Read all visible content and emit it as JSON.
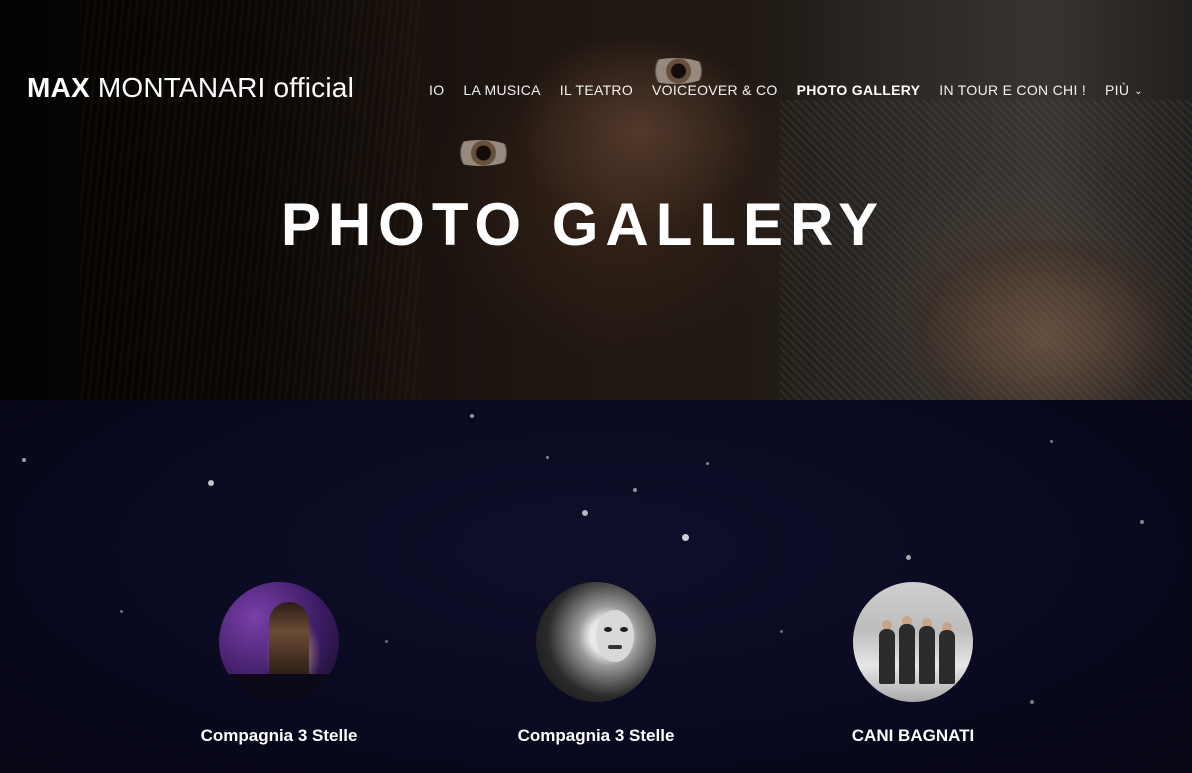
{
  "header": {
    "logo_bold": "MAX",
    "logo_light": "MONTANARI",
    "logo_suffix": "official",
    "nav": [
      {
        "label": "IO",
        "active": false
      },
      {
        "label": "LA MUSICA",
        "active": false
      },
      {
        "label": "IL TEATRO",
        "active": false
      },
      {
        "label": "VOICEOVER & CO",
        "active": false
      },
      {
        "label": "PHOTO GALLERY",
        "active": true
      },
      {
        "label": "IN TOUR E CON CHI !",
        "active": false
      },
      {
        "label": "PIÙ",
        "active": false,
        "icon": "chevron-down-icon"
      }
    ]
  },
  "hero": {
    "title": "PHOTO GALLERY"
  },
  "gallery": {
    "items": [
      {
        "caption": "Compagnia 3 Stelle",
        "thumb_alt": "Compagnia 3 Stelle thumbnail"
      },
      {
        "caption": "Compagnia 3 Stelle",
        "thumb_alt": "Compagnia 3 Stelle thumbnail"
      },
      {
        "caption": "CANI BAGNATI",
        "thumb_alt": "CANI BAGNATI thumbnail"
      }
    ]
  },
  "colors": {
    "text": "#ffffff",
    "section_bg": "#0a0a1e"
  }
}
